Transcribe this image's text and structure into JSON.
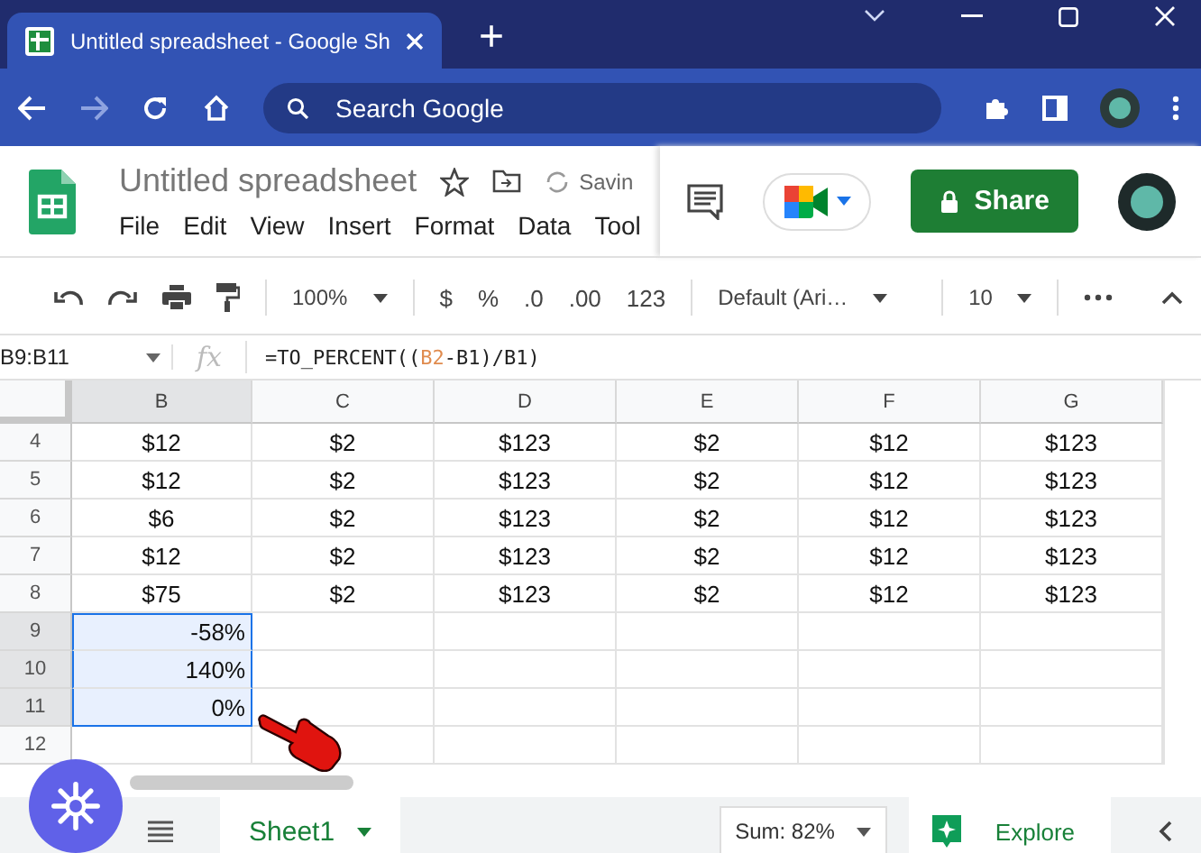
{
  "browser": {
    "tab_title": "Untitled spreadsheet - Google Sh",
    "new_tab": "+",
    "search": {
      "placeholder": "Search Google"
    }
  },
  "doc": {
    "title": "Untitled spreadsheet",
    "status": "Savin",
    "menu": [
      "File",
      "Edit",
      "View",
      "Insert",
      "Format",
      "Data",
      "Tool"
    ],
    "share": "Share"
  },
  "toolbar": {
    "zoom": "100%",
    "items": [
      "$",
      "%",
      ".0",
      ".00",
      "123"
    ],
    "font": "Default (Ari…",
    "size": "10"
  },
  "formula_bar": {
    "name_box": "B9:B11",
    "fx": "fx",
    "parts": [
      {
        "text": "=TO_PERCENT((",
        "reference": false
      },
      {
        "text": "B2",
        "reference": true
      },
      {
        "text": "-B1)/B1)",
        "reference": false
      }
    ]
  },
  "columns": [
    {
      "label": "B",
      "selected": true
    },
    {
      "label": "C",
      "selected": false
    },
    {
      "label": "D",
      "selected": false
    },
    {
      "label": "E",
      "selected": false
    },
    {
      "label": "F",
      "selected": false
    },
    {
      "label": "G",
      "selected": false
    }
  ],
  "rows": [
    {
      "number": "4",
      "selected": false,
      "kind": "value",
      "cells": [
        "$12",
        "$2",
        "$123",
        "$2",
        "$12",
        "$123"
      ]
    },
    {
      "number": "5",
      "selected": false,
      "kind": "value",
      "cells": [
        "$12",
        "$2",
        "$123",
        "$2",
        "$12",
        "$123"
      ]
    },
    {
      "number": "6",
      "selected": false,
      "kind": "value",
      "cells": [
        "$6",
        "$2",
        "$123",
        "$2",
        "$12",
        "$123"
      ]
    },
    {
      "number": "7",
      "selected": false,
      "kind": "value",
      "cells": [
        "$12",
        "$2",
        "$123",
        "$2",
        "$12",
        "$123"
      ]
    },
    {
      "number": "8",
      "selected": false,
      "kind": "value",
      "cells": [
        "$75",
        "$2",
        "$123",
        "$2",
        "$12",
        "$123"
      ]
    },
    {
      "number": "9",
      "selected": true,
      "kind": "result",
      "cells": [
        "-58%",
        "",
        "",
        "",
        "",
        ""
      ]
    },
    {
      "number": "10",
      "selected": true,
      "kind": "result",
      "cells": [
        "140%",
        "",
        "",
        "",
        "",
        ""
      ]
    },
    {
      "number": "11",
      "selected": true,
      "kind": "result",
      "cells": [
        "0%",
        "",
        "",
        "",
        "",
        ""
      ]
    },
    {
      "number": "12",
      "selected": false,
      "kind": "result",
      "cells": [
        "",
        "",
        "",
        "",
        "",
        ""
      ]
    }
  ],
  "bottom": {
    "sheets": [
      {
        "name": "Sheet1",
        "selected": true
      }
    ],
    "sum": "Sum: 82%",
    "explore": "Explore"
  }
}
